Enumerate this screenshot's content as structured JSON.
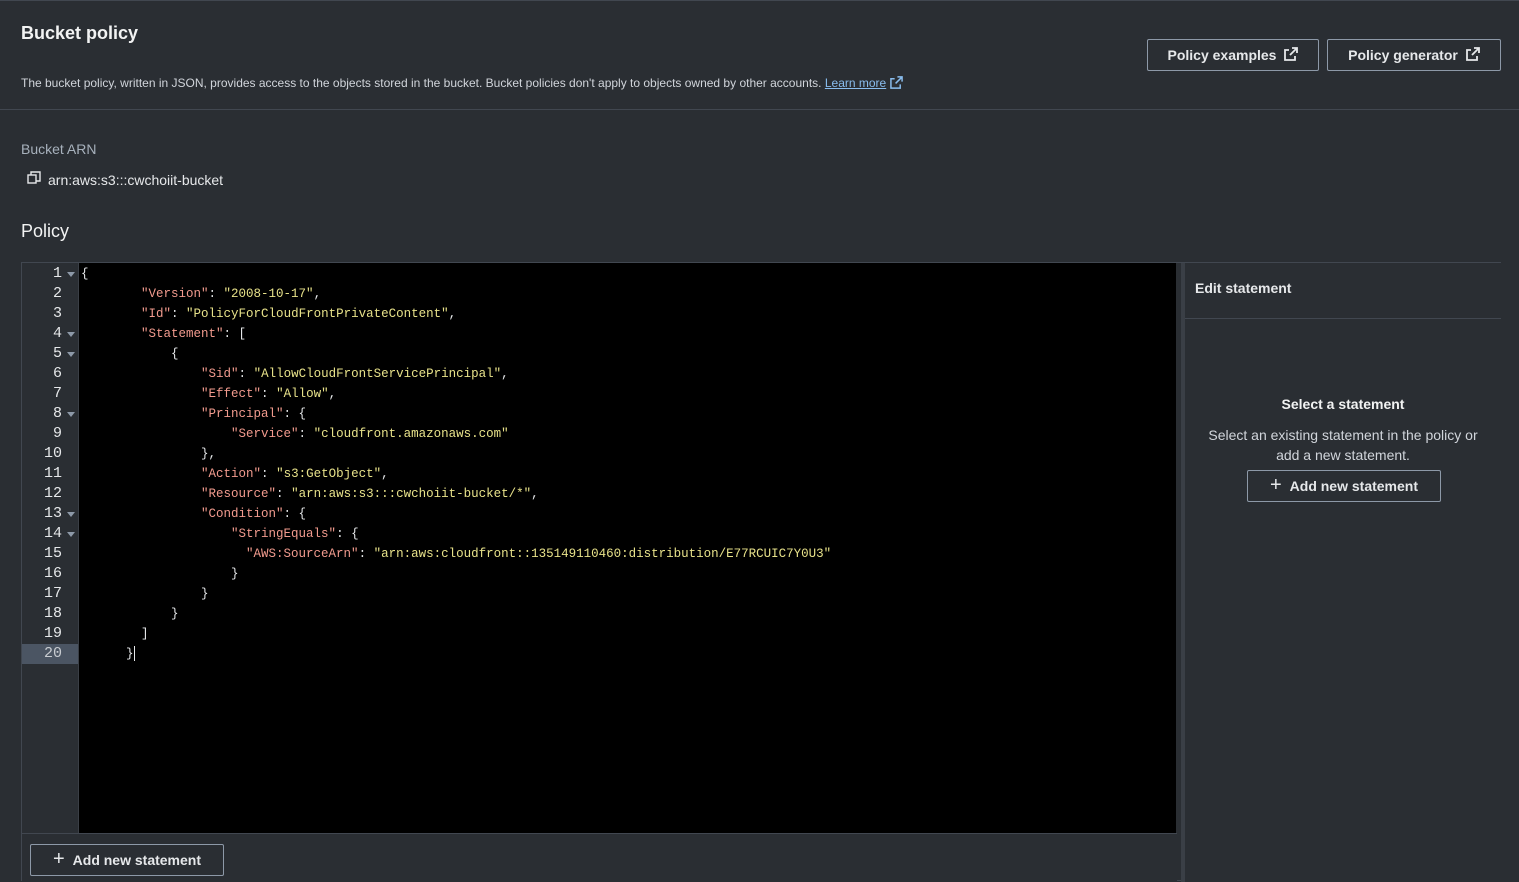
{
  "header": {
    "title": "Bucket policy",
    "description": "The bucket policy, written in JSON, provides access to the objects stored in the bucket. Bucket policies don't apply to objects owned by other accounts.",
    "learn_more": "Learn more",
    "policy_examples": "Policy examples",
    "policy_generator": "Policy generator"
  },
  "arn": {
    "label": "Bucket ARN",
    "value": "arn:aws:s3:::cwchoiit-bucket"
  },
  "policy": {
    "label": "Policy",
    "lines": [
      "{",
      "        \"Version\": \"2008-10-17\",",
      "        \"Id\": \"PolicyForCloudFrontPrivateContent\",",
      "        \"Statement\": [",
      "            {",
      "                \"Sid\": \"AllowCloudFrontServicePrincipal\",",
      "                \"Effect\": \"Allow\",",
      "                \"Principal\": {",
      "                    \"Service\": \"cloudfront.amazonaws.com\"",
      "                },",
      "                \"Action\": \"s3:GetObject\",",
      "                \"Resource\": \"arn:aws:s3:::cwchoiit-bucket/*\",",
      "                \"Condition\": {",
      "                    \"StringEquals\": {",
      "                      \"AWS:SourceArn\": \"arn:aws:cloudfront::135149110460:distribution/E77RCUIC7Y0U3\"",
      "                    }",
      "                }",
      "            }",
      "        ]",
      "      }"
    ],
    "active_line": 20,
    "fold_lines": [
      1,
      4,
      5,
      8,
      13,
      14
    ],
    "add_new_statement": "Add new statement"
  },
  "side_panel": {
    "title": "Edit statement",
    "empty_title": "Select a statement",
    "empty_text": "Select an existing statement in the policy or add a new statement.",
    "add_new_statement": "Add new statement"
  }
}
